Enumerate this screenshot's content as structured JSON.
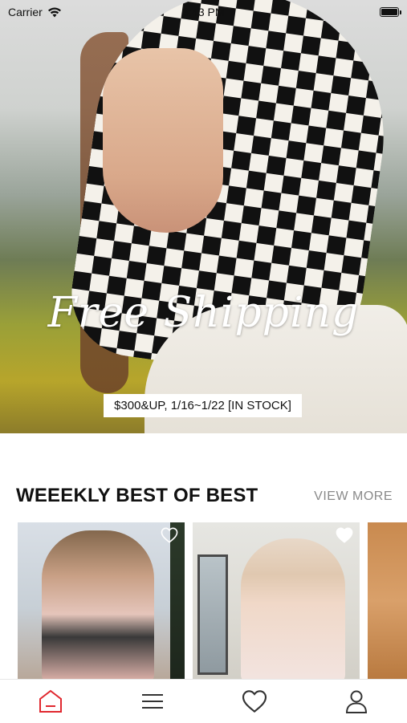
{
  "status_bar": {
    "carrier": "Carrier",
    "time": "3:43 PM",
    "wifi_icon": "wifi-icon",
    "battery_icon": "battery-icon",
    "battery_level": 1.0
  },
  "hero": {
    "headline": "Free Shipping",
    "tag": "$300&UP, 1/16~1/22 [IN STOCK]"
  },
  "weekly_best": {
    "title": "WEEEKLY BEST OF BEST",
    "view_more": "VIEW MORE",
    "products": [
      {
        "icon": "heart-icon",
        "favorited": false
      },
      {
        "icon": "heart-icon",
        "favorited": true
      },
      {
        "icon": "heart-icon",
        "favorited": false
      }
    ]
  },
  "tab_bar": {
    "tabs": [
      {
        "name": "home",
        "icon": "home-icon",
        "active": true
      },
      {
        "name": "menu",
        "icon": "menu-icon",
        "active": false
      },
      {
        "name": "wishlist",
        "icon": "heart-icon",
        "active": false
      },
      {
        "name": "account",
        "icon": "user-icon",
        "active": false
      }
    ],
    "active_color": "#e0282f",
    "inactive_color": "#333333"
  }
}
